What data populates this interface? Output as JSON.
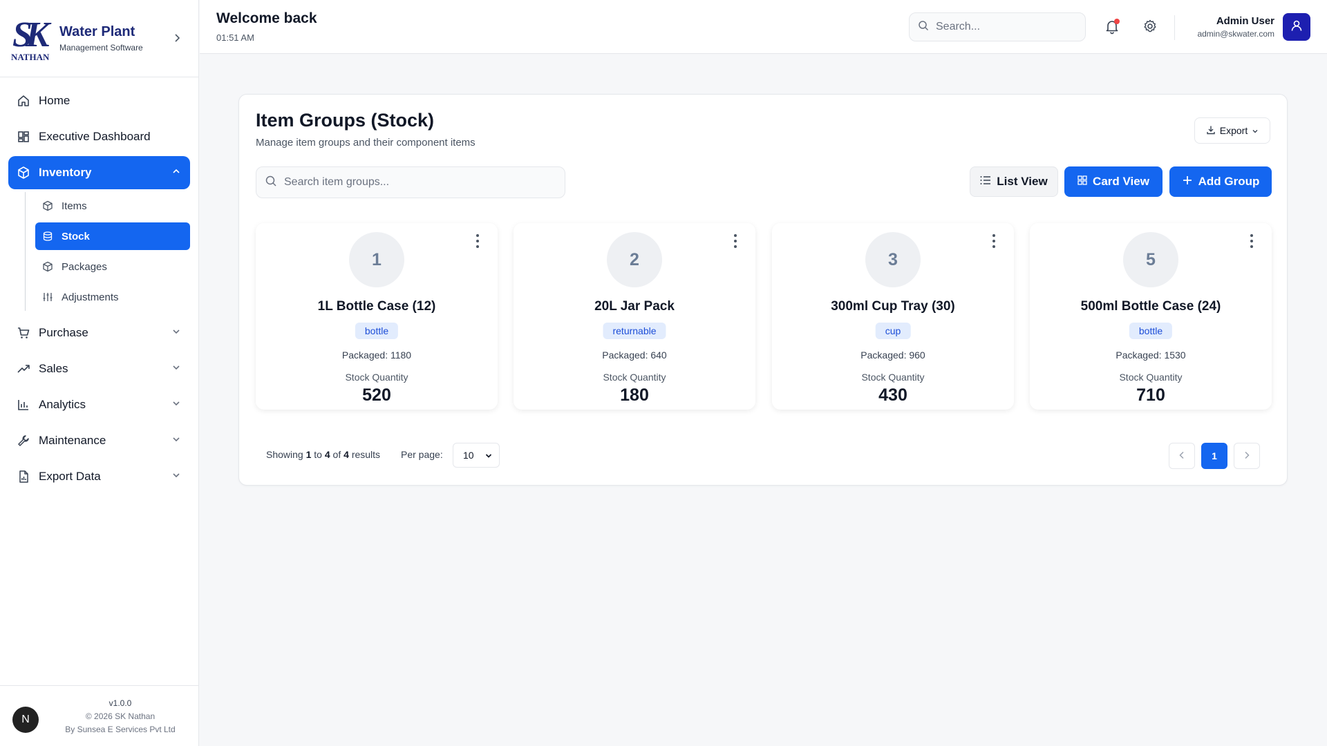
{
  "brand": {
    "logo_main": "SK",
    "logo_sub": "NATHAN",
    "title": "Water Plant",
    "subtitle": "Management Software"
  },
  "nav": {
    "home": "Home",
    "executive_dashboard": "Executive Dashboard",
    "inventory": "Inventory",
    "inventory_sub": {
      "items": "Items",
      "stock": "Stock",
      "packages": "Packages",
      "adjustments": "Adjustments"
    },
    "purchase": "Purchase",
    "sales": "Sales",
    "analytics": "Analytics",
    "maintenance": "Maintenance",
    "export_data": "Export Data"
  },
  "footer": {
    "avatar": "N",
    "version": "v1.0.0",
    "copyright": "© 2026 SK Nathan",
    "company": "By Sunsea E Services Pvt Ltd"
  },
  "header": {
    "welcome": "Welcome back",
    "time": "01:51 AM",
    "search_placeholder": "Search...",
    "user_name": "Admin User",
    "user_email": "admin@skwater.com"
  },
  "page": {
    "title": "Item Groups (Stock)",
    "subtitle": "Manage item groups and their component items",
    "export_label": "Export",
    "search_placeholder": "Search item groups...",
    "list_view_label": "List View",
    "card_view_label": "Card View",
    "add_group_label": "Add Group"
  },
  "cards": [
    {
      "number": "1",
      "name": "1L Bottle Case (12)",
      "tag": "bottle",
      "packaged": "Packaged: 1180",
      "stock_label": "Stock Quantity",
      "stock": "520"
    },
    {
      "number": "2",
      "name": "20L Jar Pack",
      "tag": "returnable",
      "packaged": "Packaged: 640",
      "stock_label": "Stock Quantity",
      "stock": "180"
    },
    {
      "number": "3",
      "name": "300ml Cup Tray (30)",
      "tag": "cup",
      "packaged": "Packaged: 960",
      "stock_label": "Stock Quantity",
      "stock": "430"
    },
    {
      "number": "5",
      "name": "500ml Bottle Case (24)",
      "tag": "bottle",
      "packaged": "Packaged: 1530",
      "stock_label": "Stock Quantity",
      "stock": "710"
    }
  ],
  "pagination": {
    "showing_prefix": "Showing",
    "from": "1",
    "to_word": "to",
    "to": "4",
    "of_word": "of",
    "total": "4",
    "results_word": "results",
    "per_page_label": "Per page:",
    "per_page_value": "10",
    "current_page": "1"
  },
  "colors": {
    "accent": "#1466f0",
    "brand": "#1e2a78",
    "tag_bg": "#e2ecfd",
    "notification_dot": "#ef4444"
  }
}
